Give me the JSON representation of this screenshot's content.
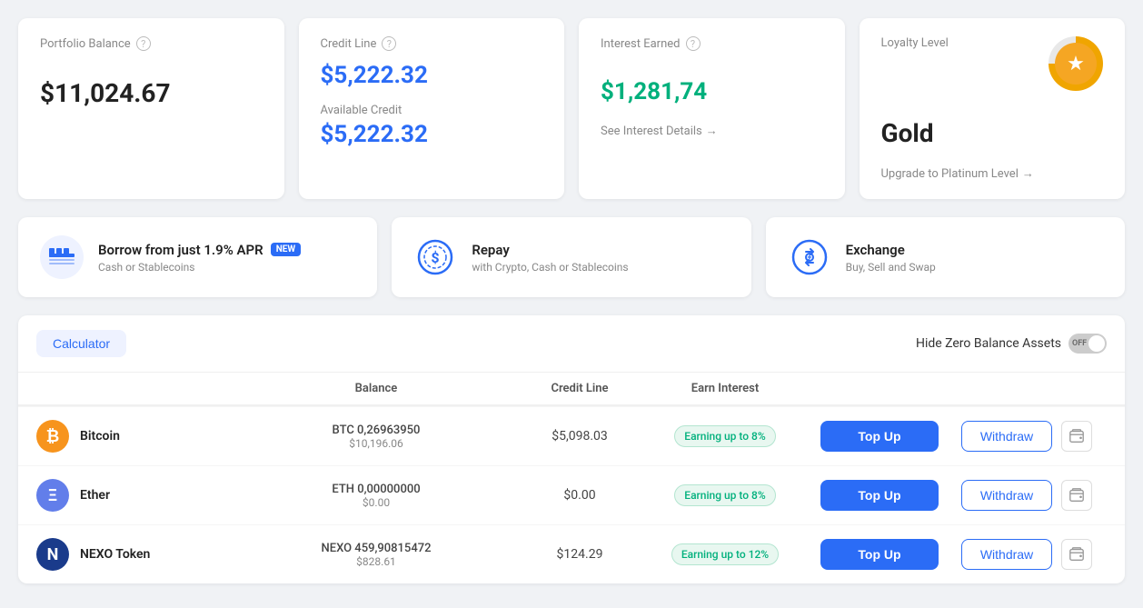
{
  "top_cards": {
    "portfolio": {
      "label": "Portfolio Balance",
      "value": "$11,024.67"
    },
    "credit": {
      "label": "Credit Line",
      "value": "$5,222.32",
      "sub_label": "Available Credit",
      "sub_value": "$5,222.32"
    },
    "interest": {
      "label": "Interest Earned",
      "value": "$1,281,74",
      "link_text": "See Interest Details",
      "link_arrow": "→"
    },
    "loyalty": {
      "label": "Loyalty Level",
      "value": "Gold",
      "link_text": "Upgrade to Platinum Level",
      "link_arrow": "→"
    }
  },
  "feature_cards": [
    {
      "id": "borrow",
      "title": "Borrow from just 1.9% APR",
      "badge": "NEW",
      "subtitle": "Cash or Stablecoins"
    },
    {
      "id": "repay",
      "title": "Repay",
      "subtitle": "with Crypto, Cash or Stablecoins"
    },
    {
      "id": "exchange",
      "title": "Exchange",
      "subtitle": "Buy, Sell and Swap"
    }
  ],
  "table": {
    "calculator_label": "Calculator",
    "columns": [
      "",
      "Balance",
      "Credit Line",
      "Earn Interest",
      "",
      "",
      ""
    ],
    "hide_zero_label": "Hide Zero Balance Assets",
    "toggle_state": "OFF",
    "assets": [
      {
        "name": "Bitcoin",
        "symbol": "BTC",
        "color": "#f7941d",
        "glyph": "₿",
        "balance_crypto": "BTC 0,26963950",
        "balance_usd": "$10,196.06",
        "credit_line": "$5,098.03",
        "earn_interest": "Earning up to 8%",
        "topup_label": "Top Up",
        "withdraw_label": "Withdraw"
      },
      {
        "name": "Ether",
        "symbol": "ETH",
        "color": "#627eea",
        "glyph": "Ξ",
        "balance_crypto": "ETH 0,00000000",
        "balance_usd": "$0.00",
        "credit_line": "$0.00",
        "earn_interest": "Earning up to 8%",
        "topup_label": "Top Up",
        "withdraw_label": "Withdraw"
      },
      {
        "name": "NEXO Token",
        "symbol": "NEXO",
        "color": "#1a3b8b",
        "glyph": "N",
        "balance_crypto": "NEXO 459,90815472",
        "balance_usd": "$828.61",
        "credit_line": "$124.29",
        "earn_interest": "Earning up to 12%",
        "topup_label": "Top Up",
        "withdraw_label": "Withdraw"
      }
    ]
  }
}
